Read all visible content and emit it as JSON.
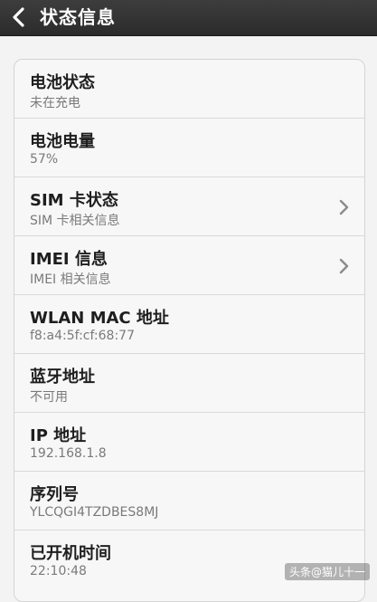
{
  "header": {
    "title": "状态信息",
    "back_icon": "chevron-left-icon"
  },
  "rows": [
    {
      "title": "电池状态",
      "subtitle": "未在充电",
      "arrow": false
    },
    {
      "title": "电池电量",
      "subtitle": "57%",
      "arrow": false
    },
    {
      "title": "SIM 卡状态",
      "subtitle": "SIM 卡相关信息",
      "arrow": true
    },
    {
      "title": "IMEI 信息",
      "subtitle": "IMEI 相关信息",
      "arrow": true
    },
    {
      "title": "WLAN MAC 地址",
      "subtitle": "f8:a4:5f:cf:68:77",
      "arrow": false
    },
    {
      "title": "蓝牙地址",
      "subtitle": "不可用",
      "arrow": false
    },
    {
      "title": "IP 地址",
      "subtitle": "192.168.1.8",
      "arrow": false
    },
    {
      "title": "序列号",
      "subtitle": "YLCQGI4TZDBES8MJ",
      "arrow": false
    },
    {
      "title": "已开机时间",
      "subtitle": "22:10:48",
      "arrow": false
    }
  ],
  "watermark": "头条@猫儿十一",
  "colors": {
    "titlebar": "#333333",
    "background": "#f3f3f3",
    "card": "#f7f7f7"
  }
}
